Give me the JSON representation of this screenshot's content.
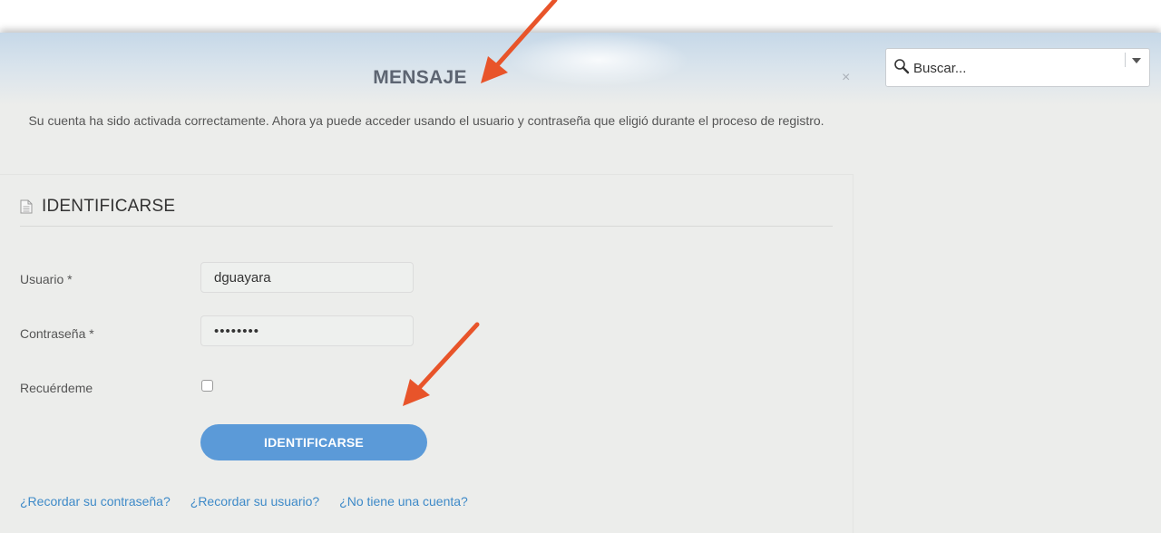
{
  "message": {
    "title": "MENSAJE",
    "close_label": "×",
    "body": "Su cuenta ha sido activada correctamente. Ahora ya puede acceder usando el usuario y contraseña que eligió durante el proceso de registro."
  },
  "search": {
    "placeholder": "Buscar..."
  },
  "login": {
    "title": "IDENTIFICARSE",
    "username_label": "Usuario *",
    "username_value": "dguayara",
    "password_label": "Contraseña *",
    "password_value": "••••••••",
    "remember_label": "Recuérdeme",
    "remember_checked": false,
    "submit_label": "IDENTIFICARSE",
    "links": [
      {
        "label": "¿Recordar su contraseña?"
      },
      {
        "label": "¿Recordar su usuario?"
      },
      {
        "label": "¿No tiene una cuenta?"
      }
    ]
  },
  "icons": {
    "search": "search-icon",
    "document": "document-icon",
    "dropdown": "chevron-down-icon",
    "close": "close-icon"
  },
  "colors": {
    "primary_button": "#5b9ad8",
    "link": "#3e8ac8",
    "annotation_arrow": "#e8542a",
    "background": "#ecedeb"
  }
}
